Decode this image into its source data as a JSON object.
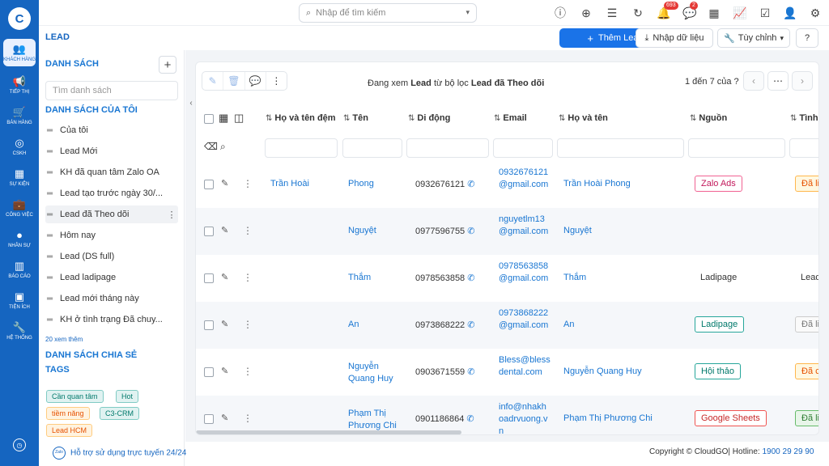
{
  "rail": {
    "logo": "C",
    "items": [
      {
        "label": "KHÁCH HÀNG",
        "icon": "users-icon",
        "glyph": "👥"
      },
      {
        "label": "TIẾP THỊ",
        "icon": "megaphone-icon",
        "glyph": "📢"
      },
      {
        "label": "BÁN HÀNG",
        "icon": "cart-icon",
        "glyph": "🛒"
      },
      {
        "label": "CSKH",
        "icon": "support-icon",
        "glyph": "◎"
      },
      {
        "label": "SỰ KIỆN",
        "icon": "calendar-icon",
        "glyph": "▦"
      },
      {
        "label": "CÔNG VIỆC",
        "icon": "briefcase-icon",
        "glyph": "💼"
      },
      {
        "label": "NHÂN SỰ",
        "icon": "person-icon",
        "glyph": "●"
      },
      {
        "label": "BÁO CÁO",
        "icon": "report-icon",
        "glyph": "▥"
      },
      {
        "label": "TIỆN ÍCH",
        "icon": "boxes-icon",
        "glyph": "▣"
      },
      {
        "label": "HỆ THỐNG",
        "icon": "wrench-icon",
        "glyph": "🔧"
      }
    ],
    "bottom_glyph": "◷"
  },
  "topbar": {
    "search_placeholder": "Nhập để tìm kiếm",
    "badges": {
      "notifications": "693",
      "messages": "2"
    }
  },
  "header": {
    "title": "LEAD",
    "add_button": "Thêm Lead",
    "import_button": "Nhập dữ liệu",
    "customize_button": "Tùy chỉnh"
  },
  "sidebar": {
    "section_lists": "DANH SÁCH",
    "search_placeholder": "Tìm danh sách",
    "my_lists_title": "DANH SÁCH CỦA TÔI",
    "items": [
      "Của tôi",
      "Lead Mới",
      "KH đã quan tâm Zalo OA",
      "Lead tạo trước ngày 30/...",
      "Lead đã Theo dõi",
      "Hôm nay",
      "Lead (DS full)",
      "Lead ladipage",
      "Lead mới tháng này",
      "KH ở tình trạng Đã chuy..."
    ],
    "more_text": "20 xem thêm",
    "shared_title": "DANH SÁCH CHIA SẺ",
    "tags_title": "TAGS",
    "tags": [
      "Cần quan tâm",
      "Hot",
      "tiềm năng",
      "C3-CRM",
      "Lead HCM"
    ]
  },
  "support": {
    "zalo": "Zalo",
    "text": "Hỗ trợ sử dụng trực tuyến 24/24"
  },
  "view": {
    "prefix": "Đang xem ",
    "entity": "Lead",
    "middle": " từ bộ lọc ",
    "filter": "Lead đã Theo dõi",
    "pager": "1 đến 7 của ?"
  },
  "table": {
    "headers": [
      "Họ và tên đệm",
      "Tên",
      "Di động",
      "Email",
      "Họ và tên",
      "Nguồn",
      "Tình"
    ],
    "rows": [
      {
        "middle": "Trần Hoài",
        "first": "Phong",
        "phone": "0932676121",
        "email": "0932676121@gmail.com",
        "full": "Trần Hoài Phong",
        "source": "Zalo Ads",
        "status": "Đã li"
      },
      {
        "middle": "",
        "first": "Nguyệt",
        "phone": "0977596755",
        "email": "nguyetlm13@gmail.com",
        "full": "Nguyệt",
        "source": "",
        "status": ""
      },
      {
        "middle": "",
        "first": "Thắm",
        "phone": "0978563858",
        "email": "0978563858@gmail.com",
        "full": "Thắm",
        "source": "Ladipage",
        "status": "Lead"
      },
      {
        "middle": "",
        "first": "An",
        "phone": "0973868222",
        "email": "0973868222@gmail.com",
        "full": "An",
        "source": "Ladipage",
        "status": "Đã li"
      },
      {
        "middle": "",
        "first": "Nguyễn Quang Huy",
        "phone": "0903671559",
        "email": "Bless@blessdental.com",
        "full": "Nguyễn Quang Huy",
        "source": "Hội thảo",
        "status": "Đã c"
      },
      {
        "middle": "",
        "first": "Phạm Thị Phương Chi",
        "phone": "0901186864",
        "email": "info@nhakhoadrvuong.vn",
        "full": "Phạm Thị Phương Chi",
        "source": "Google Sheets",
        "status": "Đã liê"
      }
    ]
  },
  "footer": {
    "copyright": "Copyright © CloudGO",
    "hotline_label": "| Hotline: ",
    "hotline": "1900 29 29 90"
  }
}
